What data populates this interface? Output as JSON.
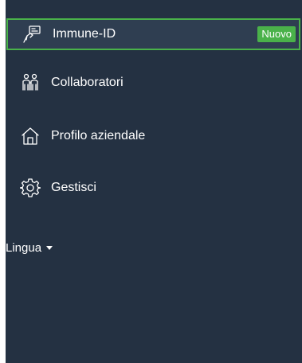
{
  "menu": {
    "items": [
      {
        "label": "Immune-ID",
        "icon": "card-hand-icon",
        "active": true,
        "badge": "Nuovo"
      },
      {
        "label": "Collaboratori",
        "icon": "people-icon"
      },
      {
        "label": "Profilo aziendale",
        "icon": "home-icon"
      },
      {
        "label": "Gestisci",
        "icon": "gear-icon"
      }
    ]
  },
  "language": {
    "label": "Lingua"
  },
  "colors": {
    "sidebar_bg": "#243142",
    "active_bg": "#2f3e51",
    "accent": "#4ab24a",
    "text": "#ffffff"
  }
}
